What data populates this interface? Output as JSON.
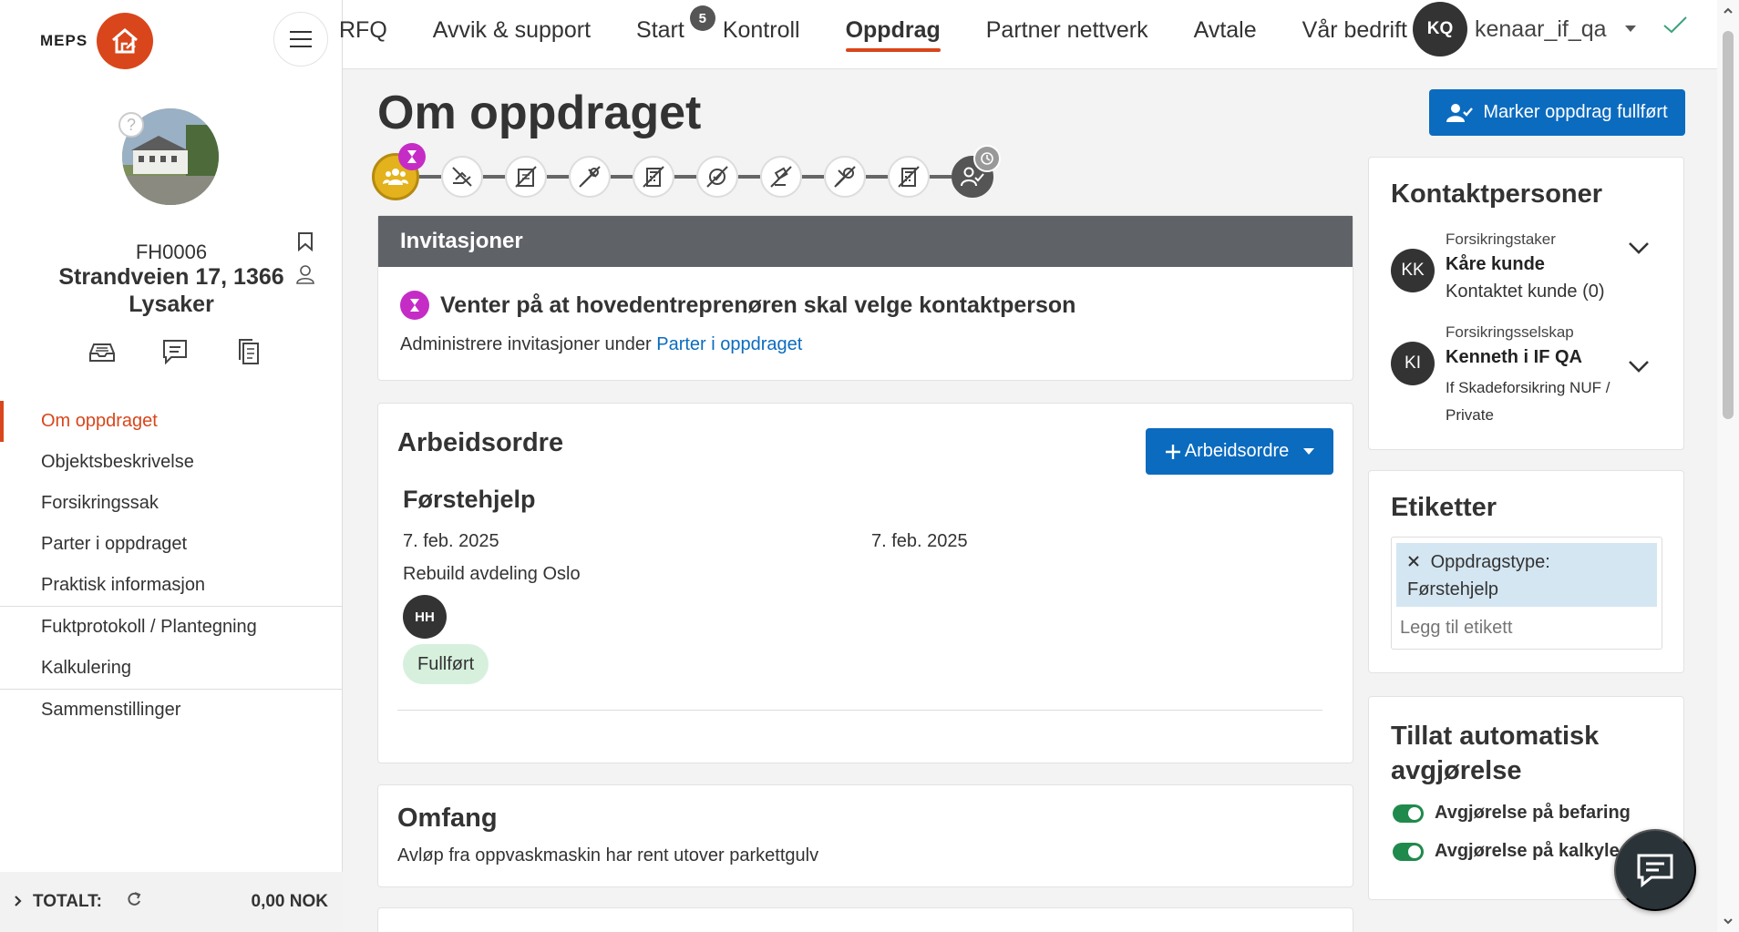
{
  "brand": {
    "name": "MEPS"
  },
  "sidebar": {
    "object_id": "FH0006",
    "address": "Strandveien 17, 1366 Lysaker",
    "nav": [
      {
        "label": "Om oppdraget",
        "active": true
      },
      {
        "label": "Objektsbeskrivelse"
      },
      {
        "label": "Forsikringssak"
      },
      {
        "label": "Parter i oppdraget"
      },
      {
        "label": "Praktisk informasjon"
      },
      {
        "label": "Fuktprotokoll / Plantegning"
      },
      {
        "label": "Kalkulering"
      },
      {
        "label": "Sammenstillinger"
      }
    ],
    "total_label": "TOTALT:",
    "total_amount": "0,00 NOK"
  },
  "topnav": {
    "items": [
      "RFQ",
      "Avvik & support",
      "Start",
      "Kontroll",
      "Oppdrag",
      "Partner nettverk",
      "Avtale",
      "Vår bedrift"
    ],
    "active": "Oppdrag",
    "start_badge": "5",
    "user_initials": "KQ",
    "user_name": "kenaar_if_qa"
  },
  "main": {
    "title": "Om oppdraget",
    "complete_button": "Marker oppdrag fullført",
    "invitations": {
      "header": "Invitasjoner",
      "status": "Venter på at hovedentreprenøren skal velge kontaktperson",
      "text": "Administrere invitasjoner under",
      "link": "Parter i oppdraget"
    },
    "work_orders": {
      "title": "Arbeidsordre",
      "button": "Arbeidsordre",
      "item": {
        "title": "Førstehjelp",
        "date_start": "7. feb. 2025",
        "date_end": "7. feb. 2025",
        "subtitle": "Rebuild avdeling Oslo",
        "assignee_initials": "HH",
        "status": "Fullført"
      }
    },
    "scope": {
      "title": "Omfang",
      "text": "Avløp fra oppvaskmaskin har rent utover parkettgulv"
    }
  },
  "contacts": {
    "title": "Kontaktpersoner",
    "people": [
      {
        "initials": "KK",
        "role": "Forsikringstaker",
        "name": "Kåre kunde",
        "extra": "Kontaktet kunde (0)"
      },
      {
        "initials": "KI",
        "role": "Forsikringsselskap",
        "name": "Kenneth i IF QA",
        "extra": "If Skadeforsikring NUF / Private"
      }
    ]
  },
  "tags": {
    "title": "Etiketter",
    "items": [
      "Oppdragstype: Førstehjelp"
    ],
    "placeholder": "Legg til etikett"
  },
  "auto_decision": {
    "title": "Tillat automatisk avgjørelse",
    "toggles": [
      {
        "label": "Avgjørelse på befaring",
        "on": true
      },
      {
        "label": "Avgjørelse på kalkyle",
        "on": true
      }
    ]
  },
  "colors": {
    "accent": "#d9461b",
    "primary": "#0b6bbf",
    "pending": "#c52cc6",
    "success": "#1f8a4c"
  }
}
